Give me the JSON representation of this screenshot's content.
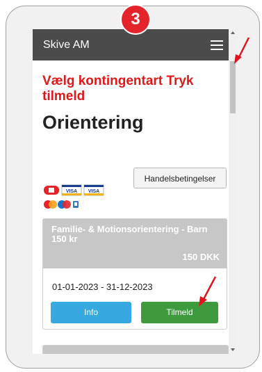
{
  "step_badge": "3",
  "header": {
    "title": "Skive AM",
    "menu_icon": "hamburger-icon"
  },
  "headline": "Vælg kontingentart Tryk tilmeld",
  "page_title": "Orientering",
  "terms_button": "Handelsbetingelser",
  "payment_icons": [
    "dankort-icon",
    "visa-icon",
    "visa-electron-icon",
    "mastercard-icon",
    "maestro-icon",
    "mobilepay-icon"
  ],
  "payment_icon_labels": {
    "visa": "VISA",
    "visa_electron": "VISA"
  },
  "membership": {
    "title": "Familie- & Motionsorientering - Barn 150 kr",
    "price": "150 DKK",
    "period": "01-01-2023 - 31-12-2023",
    "info_button": "Info",
    "signup_button": "Tilmeld"
  },
  "colors": {
    "accent_red": "#e01818",
    "header_bg": "#4b4b4b",
    "info_blue": "#36a9e0",
    "signup_green": "#3d9a3d",
    "card_header_gray": "#c7c7c7"
  }
}
